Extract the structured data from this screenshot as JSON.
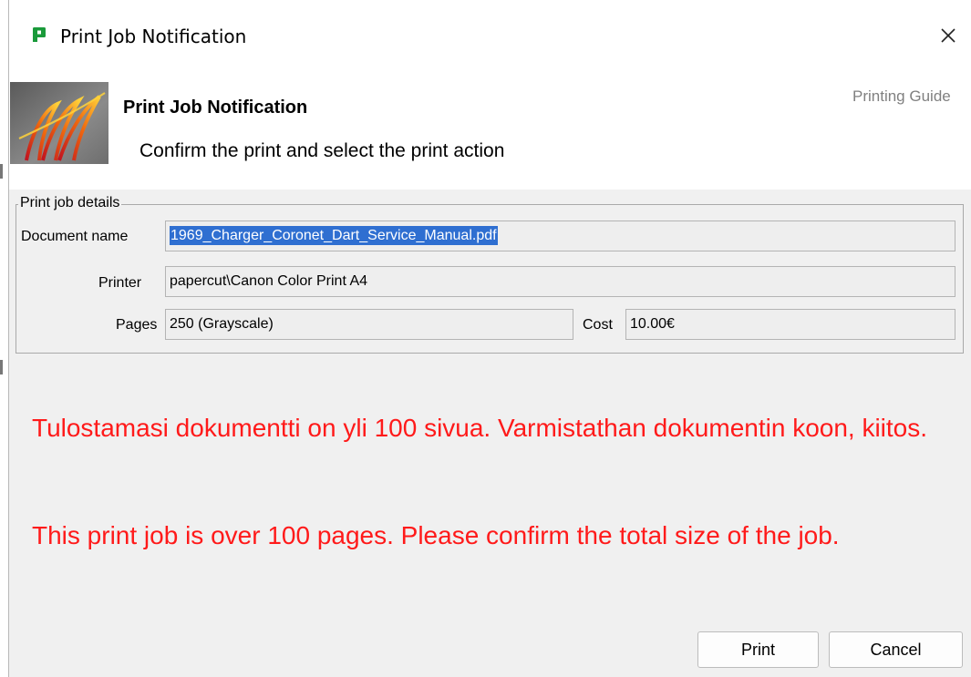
{
  "window": {
    "title": "Print Job Notification",
    "close_glyph": "✕"
  },
  "header": {
    "title": "Print Job Notification",
    "subtitle": "Confirm the print and select the print action",
    "guide_link": "Printing Guide"
  },
  "details": {
    "legend": "Print job details",
    "document_label": "Document name",
    "document_value": "1969_Charger_Coronet_Dart_Service_Manual.pdf",
    "printer_label": "Printer",
    "printer_value": "papercut\\Canon Color Print A4",
    "pages_label": "Pages",
    "pages_value": "250   (Grayscale)",
    "cost_label": "Cost",
    "cost_value": "10.00€"
  },
  "messages": {
    "finnish": "Tulostamasi dokumentti on yli 100 sivua. Varmistathan dokumentin koon, kiitos.",
    "english": "This print job is over 100 pages. Please confirm the total size of the job."
  },
  "buttons": {
    "print": "Print",
    "cancel": "Cancel"
  },
  "colors": {
    "warning_text": "#ff1a1a",
    "selection": "#2f6fd1",
    "app_icon": "#1a9a3a"
  },
  "icons": {
    "app": "papercut-logo-icon",
    "header": "papercut-logo",
    "close": "close-icon"
  }
}
